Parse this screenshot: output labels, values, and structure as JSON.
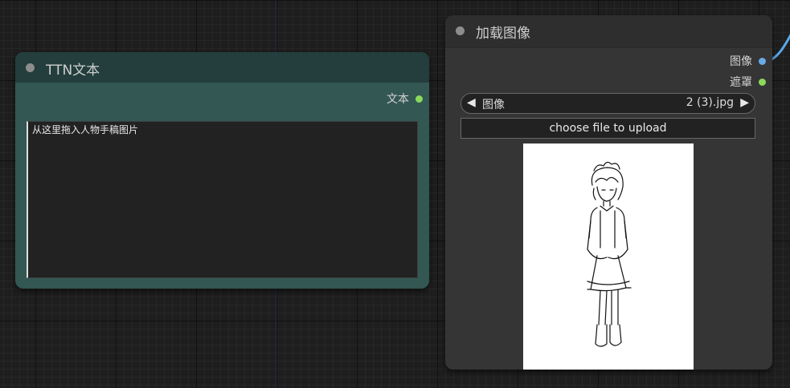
{
  "ttn_node": {
    "title": "TTN文本",
    "output_label": "文本",
    "text_value": "从这里拖入人物手稿图片"
  },
  "load_image_node": {
    "title": "加载图像",
    "outputs": [
      "图像",
      "遮罩"
    ],
    "combo_label": "图像",
    "combo_value": "2 (3).jpg",
    "combo_prev": "◀",
    "combo_next": "▶",
    "upload_label": "choose file to upload"
  },
  "colors": {
    "ttn_body": "#335753",
    "ttn_header": "#233e3c",
    "image_output_slot": "#6aa9e8",
    "mask_output_slot": "#8bd95a",
    "text_output_slot": "#8bd95a"
  }
}
